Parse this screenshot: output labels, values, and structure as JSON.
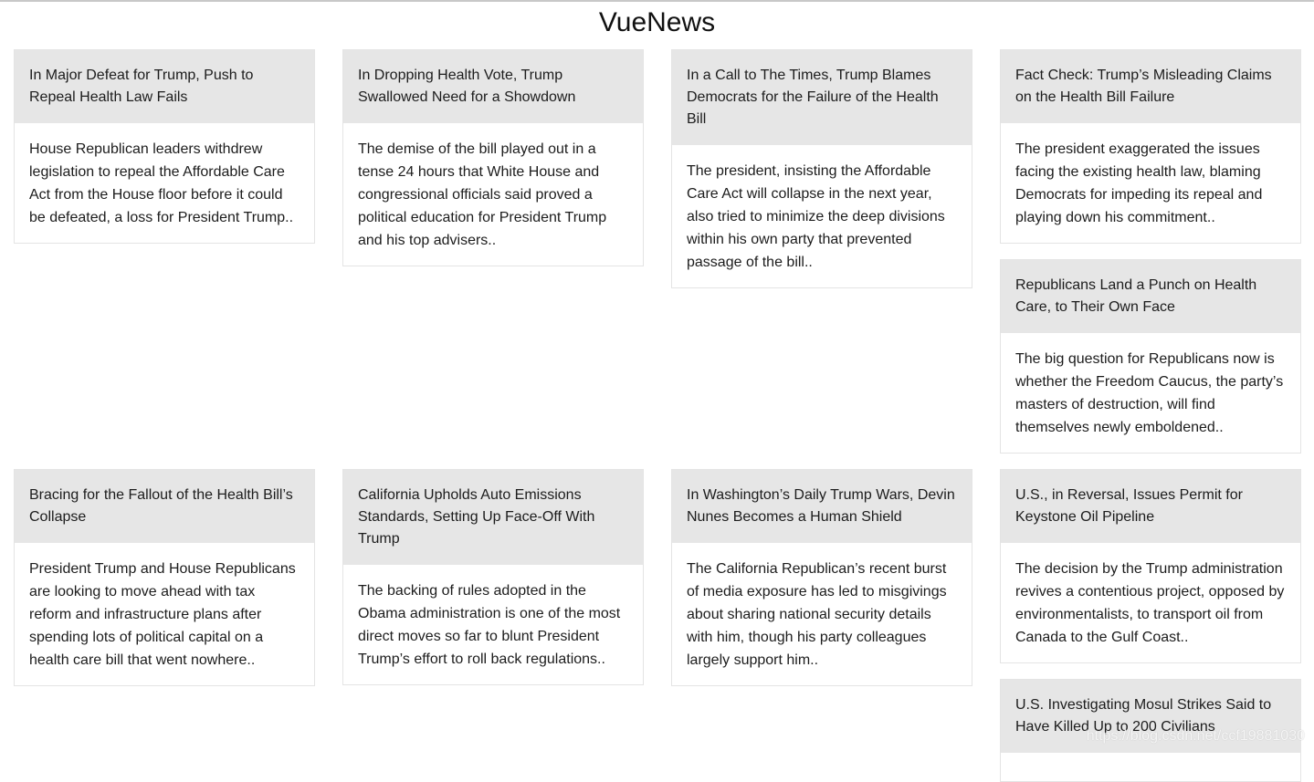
{
  "app": {
    "title": "VueNews"
  },
  "articles": [
    {
      "title": "In Major Defeat for Trump, Push to Repeal Health Law Fails",
      "abstract": "House Republican leaders withdrew legislation to repeal the Affordable Care Act from the House floor before it could be defeated, a loss for President Trump.."
    },
    {
      "title": "In Dropping Health Vote, Trump Swallowed Need for a Showdown",
      "abstract": "The demise of the bill played out in a tense 24 hours that White House and congressional officials said proved a political education for President Trump and his top advisers.."
    },
    {
      "title": "In a Call to The Times, Trump Blames Democrats for the Failure of the Health Bill",
      "abstract": "The president, insisting the Affordable Care Act will collapse in the next year, also tried to minimize the deep divisions within his own party that prevented passage of the bill.."
    },
    {
      "title": "Fact Check: Trump’s Misleading Claims on the Health Bill Failure",
      "abstract": "The president exaggerated the issues facing the existing health law, blaming Democrats for impeding its repeal and playing down his commitment.."
    },
    {
      "title": "Republicans Land a Punch on Health Care, to Their Own Face",
      "abstract": "The big question for Republicans now is whether the Freedom Caucus, the party’s masters of destruction, will find themselves newly emboldened.."
    },
    {
      "title": "Bracing for the Fallout of the Health Bill’s Collapse",
      "abstract": "President Trump and House Republicans are looking to move ahead with tax reform and infrastructure plans after spending lots of political capital on a health care bill that went nowhere.."
    },
    {
      "title": "California Upholds Auto Emissions Standards, Setting Up Face-Off With Trump",
      "abstract": "The backing of rules adopted in the Obama administration is one of the most direct moves so far to blunt President Trump’s effort to roll back regulations.."
    },
    {
      "title": "In Washington’s Daily Trump Wars, Devin Nunes Becomes a Human Shield",
      "abstract": "The California Republican’s recent burst of media exposure has led to misgivings about sharing national security details with him, though his party colleagues largely support him.."
    },
    {
      "title": "U.S., in Reversal, Issues Permit for Keystone Oil Pipeline",
      "abstract": "The decision by the Trump administration revives a contentious project, opposed by environmentalists, to transport oil from Canada to the Gulf Coast.."
    },
    {
      "title": "U.S. Investigating Mosul Strikes Said to Have Killed Up to 200 Civilians",
      "abstract": ""
    }
  ],
  "watermark": "https://blog.csdn.net/ccf19881030"
}
